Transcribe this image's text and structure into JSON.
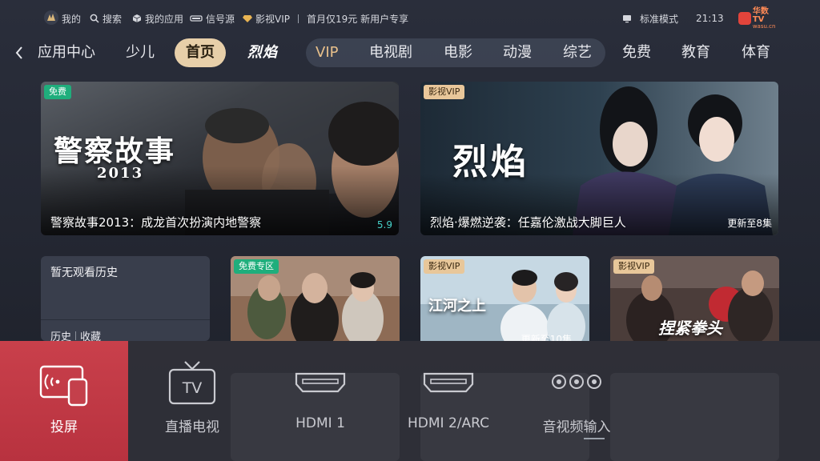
{
  "status_bar": {
    "profile": "我的",
    "search": "搜索",
    "my_apps": "我的应用",
    "signal_source": "信号源",
    "vip": "影视VIP",
    "promo": "首月仅19元 新用户专享",
    "mode": "标准模式",
    "time": "21:13",
    "brand": "华数TV",
    "brand_sub": "wasu.cn"
  },
  "nav": {
    "items": [
      "应用中心",
      "少儿",
      "首页",
      "烈焰",
      "VIP",
      "电视剧",
      "电影",
      "动漫",
      "综艺",
      "免费",
      "教育",
      "体育"
    ],
    "active": "首页"
  },
  "featured": [
    {
      "tag": "免费",
      "art_title": "警察故事",
      "art_sub": "2013",
      "caption": "警察故事2013：成龙首次扮演内地警察",
      "score": "5.9"
    },
    {
      "tag": "影视VIP",
      "art_title": "烈焰",
      "caption": "烈焰·爆燃逆袭：任嘉伦激战大脚巨人",
      "update": "更新至8集"
    }
  ],
  "history": {
    "title": "暂无观看历史",
    "history_link": "历史",
    "favorites_link": "收藏"
  },
  "small_cards": [
    {
      "tag": "免费专区"
    },
    {
      "tag": "影视VIP",
      "art_title": "江河之上",
      "update": "更新至10集"
    },
    {
      "tag": "影视VIP",
      "art_title": "捏紧拳头"
    }
  ],
  "input_sources": {
    "items": [
      {
        "label": "投屏",
        "icon": "screen-cast-icon"
      },
      {
        "label": "直播电视",
        "icon": "tv-icon"
      },
      {
        "label": "HDMI 1",
        "icon": "hdmi-port-icon"
      },
      {
        "label": "HDMI 2/ARC",
        "icon": "hdmi-port-icon"
      },
      {
        "label": "音视频输入",
        "icon": "av-input-icon"
      }
    ],
    "selected": "投屏"
  },
  "colors": {
    "accent_nav": "#e7cfa9",
    "vip_gold": "#e8c08b",
    "free_tag": "#1fae7c",
    "cast_active": "#c9404b",
    "score": "#46d1c9"
  }
}
